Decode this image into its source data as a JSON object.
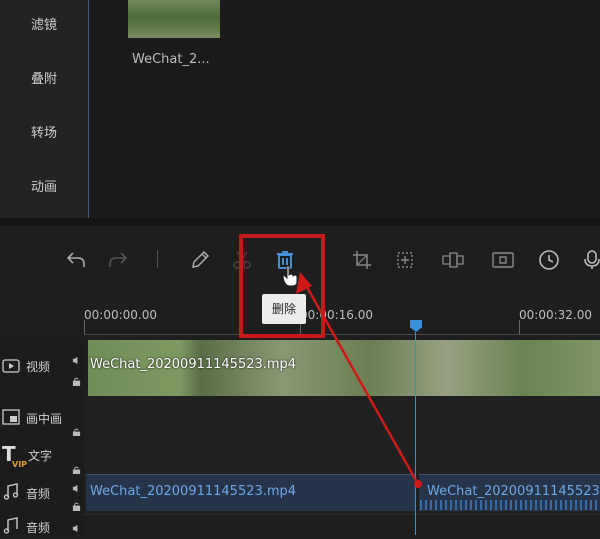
{
  "sidebar": {
    "items": [
      {
        "label": "滤镜"
      },
      {
        "label": "叠附"
      },
      {
        "label": "转场"
      },
      {
        "label": "动画"
      }
    ]
  },
  "media": {
    "items": [
      {
        "name": "WeChat_2..."
      }
    ]
  },
  "toolbar": {
    "buttons": [
      {
        "icon": "undo-icon"
      },
      {
        "icon": "redo-icon"
      },
      {
        "icon": "pencil-icon"
      },
      {
        "icon": "scissors-icon"
      },
      {
        "icon": "trash-icon"
      },
      {
        "icon": "crop-icon"
      },
      {
        "icon": "mosaic-icon"
      },
      {
        "icon": "freeze-icon"
      },
      {
        "icon": "record-icon"
      },
      {
        "icon": "duration-icon"
      },
      {
        "icon": "microphone-icon"
      }
    ],
    "tooltip": "删除"
  },
  "ruler": {
    "ticks": [
      "00:00:00.00",
      "00:00:16.00",
      "00:00:32.00"
    ]
  },
  "tracks": {
    "video": {
      "label": "视频",
      "clip": "WeChat_20200911145523.mp4"
    },
    "pip": {
      "label": "画中画"
    },
    "text": {
      "label": "文字",
      "badge": "VIP"
    },
    "audio1": {
      "label": "音频",
      "clip_left": "WeChat_20200911145523.mp4",
      "clip_right": "WeChat_20200911145523"
    },
    "audio2": {
      "label": "音频"
    }
  },
  "colors": {
    "accent": "#3a8fd6",
    "highlight": "#c8191a",
    "clip_text": "#6fa7e6"
  }
}
